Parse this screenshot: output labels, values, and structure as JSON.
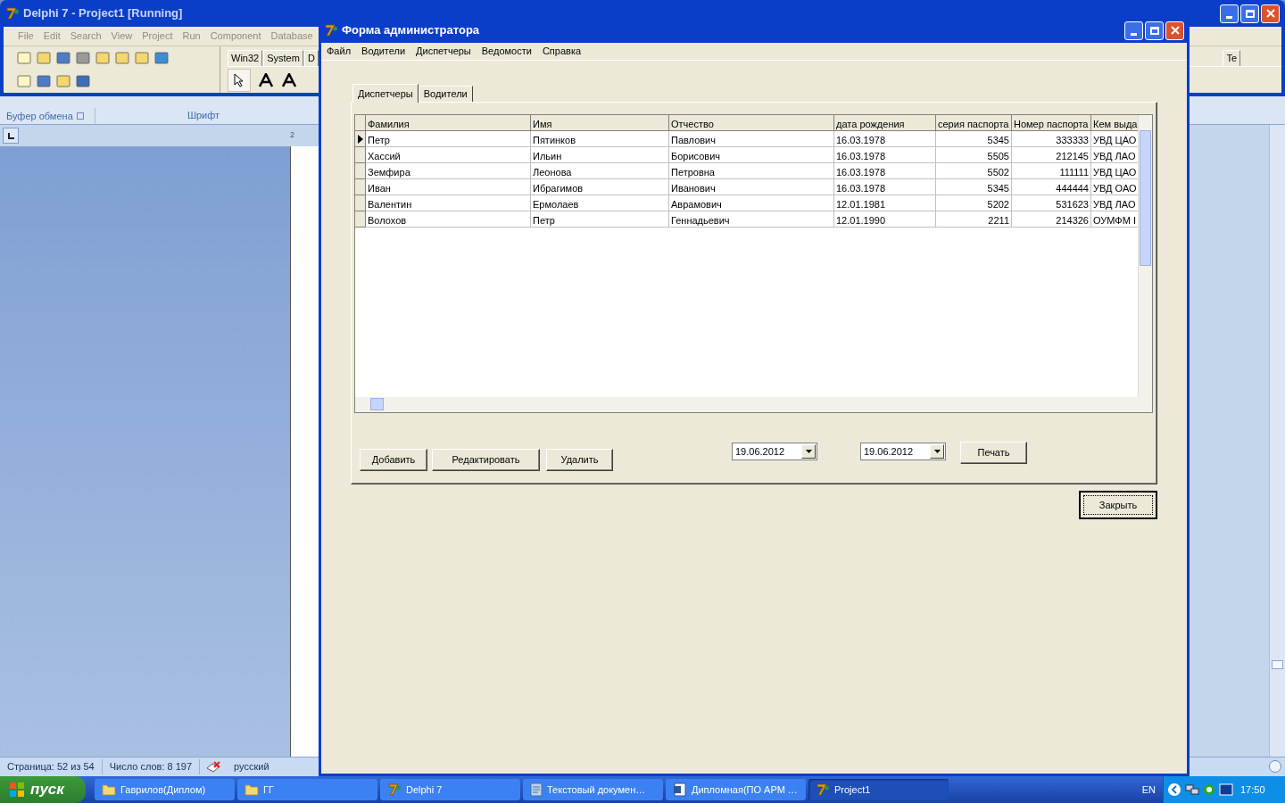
{
  "ide": {
    "title": "Delphi 7 - Project1 [Running]",
    "menu": [
      "File",
      "Edit",
      "Search",
      "View",
      "Project",
      "Run",
      "Component",
      "Database"
    ],
    "palette_tabs": [
      "Win32",
      "System",
      "D",
      "Te"
    ]
  },
  "word": {
    "ribbon_groups": [
      "Буфер обмена",
      "Шрифт"
    ],
    "ruler": "2",
    "status": [
      "Страница: 52 из 54",
      "Число слов: 8 197",
      "русский"
    ]
  },
  "dialog": {
    "title": "Форма администратора",
    "menu": [
      "Файл",
      "Водители",
      "Диспетчеры",
      "Ведомости",
      "Справка"
    ],
    "tabs": [
      {
        "label": "Диспетчеры",
        "selected": true
      },
      {
        "label": "Водители",
        "selected": false
      }
    ],
    "table": {
      "columns": [
        "Фамилия",
        "Имя",
        "Отчество",
        "дата рождения",
        "серия паспорта",
        "Номер паспорта",
        "Кем выда"
      ],
      "rows": [
        {
          "selected": true,
          "cells": [
            "Петр",
            "Пятинков",
            "Павлович",
            "16.03.1978",
            "5345",
            "333333",
            "УВД ЦАО"
          ]
        },
        {
          "selected": false,
          "cells": [
            "Хассий",
            "Ильин",
            "Борисович",
            "16.03.1978",
            "5505",
            "212145",
            "УВД ЛАО"
          ]
        },
        {
          "selected": false,
          "cells": [
            "Земфира",
            "Леонова",
            "Петровна",
            "16.03.1978",
            "5502",
            "111111",
            "УВД ЦАО"
          ]
        },
        {
          "selected": false,
          "cells": [
            "Иван",
            "Ибрагимов",
            "Иванович",
            "16.03.1978",
            "5345",
            "444444",
            "УВД ОАО"
          ]
        },
        {
          "selected": false,
          "cells": [
            "Валентин",
            "Ермолаев",
            "Аврамович",
            "12.01.1981",
            "5202",
            "531623",
            "УВД ЛАО"
          ]
        },
        {
          "selected": false,
          "cells": [
            "Волохов",
            "Петр",
            "Геннадьевич",
            "12.01.1990",
            "2211",
            "214326",
            "ОУМФМ I"
          ]
        }
      ]
    },
    "buttons": [
      "Добавить",
      "Редактировать",
      "Удалить"
    ],
    "date_from": "19.06.2012",
    "date_to": "19.06.2012",
    "print_button": "Печать",
    "close_button": "Закрыть"
  },
  "taskbar": {
    "start": "пуск",
    "tasks": [
      {
        "label": "Гаврилов(Диплом)",
        "kind": "folder",
        "selected": false
      },
      {
        "label": "ГГ",
        "kind": "folder",
        "selected": false
      },
      {
        "label": "Delphi 7",
        "kind": "delphi",
        "selected": false
      },
      {
        "label": "Текстовый докумен…",
        "kind": "note",
        "selected": false
      },
      {
        "label": "Дипломная(ПО АРМ …",
        "kind": "word",
        "selected": false
      },
      {
        "label": "Project1",
        "kind": "delphi",
        "selected": true
      }
    ],
    "language": "EN",
    "time": "17:50"
  }
}
